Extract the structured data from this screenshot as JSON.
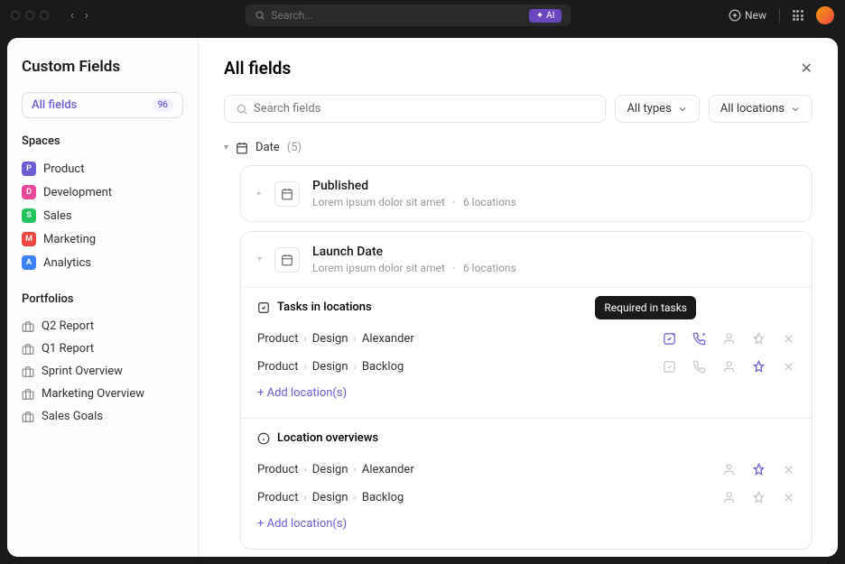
{
  "titlebar": {
    "search_placeholder": "Search...",
    "ai_label": "AI",
    "new_label": "New"
  },
  "sidebar": {
    "title": "Custom Fields",
    "all_fields_label": "All fields",
    "all_fields_count": "96",
    "spaces_label": "Spaces",
    "spaces": [
      {
        "letter": "P",
        "color": "#6d5dd3",
        "label": "Product"
      },
      {
        "letter": "D",
        "color": "#ec4899",
        "label": "Development"
      },
      {
        "letter": "S",
        "color": "#22c55e",
        "label": "Sales"
      },
      {
        "letter": "M",
        "color": "#ef4444",
        "label": "Marketing"
      },
      {
        "letter": "A",
        "color": "#3b82f6",
        "label": "Analytics"
      }
    ],
    "portfolios_label": "Portfolios",
    "portfolios": [
      {
        "label": "Q2 Report"
      },
      {
        "label": "Q1 Report"
      },
      {
        "label": "Sprint Overview"
      },
      {
        "label": "Marketing Overview"
      },
      {
        "label": "Sales Goals"
      }
    ]
  },
  "main": {
    "title": "All fields",
    "search_placeholder": "Search fields",
    "filter_types": "All types",
    "filter_locations": "All locations",
    "group_label": "Date",
    "group_count": "(5)",
    "fields": [
      {
        "title": "Published",
        "desc": "Lorem ipsum dolor sit amet",
        "locations": "6 locations"
      },
      {
        "title": "Launch Date",
        "desc": "Lorem ipsum dolor sit amet",
        "locations": "6 locations"
      }
    ],
    "tasks_section": "Tasks in locations",
    "locations_section": "Location overviews",
    "paths": [
      {
        "a": "Product",
        "b": "Design",
        "c": "Alexander"
      },
      {
        "a": "Product",
        "b": "Design",
        "c": "Backlog"
      }
    ],
    "add_location": "+ Add location(s)",
    "tooltip": "Required in tasks"
  }
}
